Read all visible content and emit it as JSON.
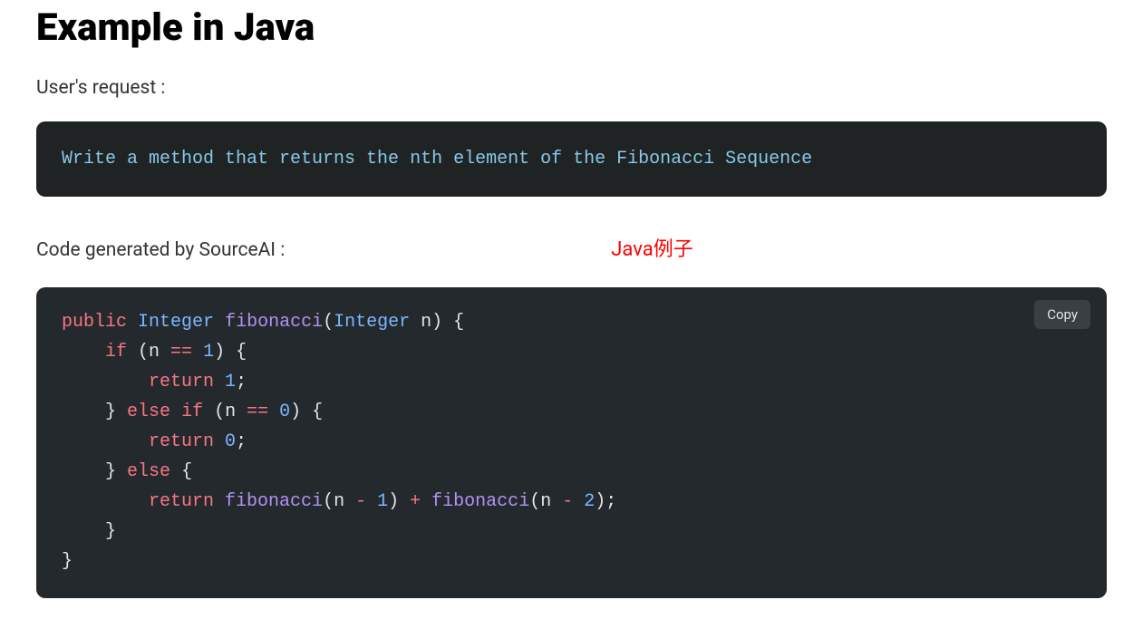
{
  "heading": "Example in Java",
  "request_label": "User's request :",
  "request_text": "Write a method that returns the nth element of the Fibonacci Sequence",
  "generated_label": "Code generated by SourceAI :",
  "annotation": "Java例子",
  "copy_label": "Copy",
  "code": {
    "line1": {
      "kw_public": "public",
      "type1": "Integer",
      "fn": "fibonacci",
      "p_open": "(",
      "type2": "Integer",
      "param": " n",
      "p_close": ")",
      "brace": " {"
    },
    "line2": {
      "indent": "    ",
      "kw_if": "if",
      "cond": " (n ",
      "op": "==",
      "sp": " ",
      "num": "1",
      "close": ") {"
    },
    "line3": {
      "indent": "        ",
      "kw_return": "return",
      "sp": " ",
      "num": "1",
      "semi": ";"
    },
    "line4": {
      "indent": "    ",
      "brace_close": "}",
      "sp": " ",
      "kw_else": "else",
      "sp2": " ",
      "kw_if": "if",
      "cond": " (n ",
      "op": "==",
      "sp3": " ",
      "num": "0",
      "close": ") {"
    },
    "line5": {
      "indent": "        ",
      "kw_return": "return",
      "sp": " ",
      "num": "0",
      "semi": ";"
    },
    "line6": {
      "indent": "    ",
      "brace_close": "}",
      "sp": " ",
      "kw_else": "else",
      "brace": " {"
    },
    "line7": {
      "indent": "        ",
      "kw_return": "return",
      "sp": " ",
      "fn1": "fibonacci",
      "args1": "(n ",
      "op1": "-",
      "sp2": " ",
      "num1": "1",
      "close1": ")",
      "plus": " + ",
      "fn2": "fibonacci",
      "args2": "(n ",
      "op2": "-",
      "sp3": " ",
      "num2": "2",
      "close2": ");"
    },
    "line8": {
      "indent": "    ",
      "brace": "}"
    },
    "line9": {
      "brace": "}"
    }
  }
}
